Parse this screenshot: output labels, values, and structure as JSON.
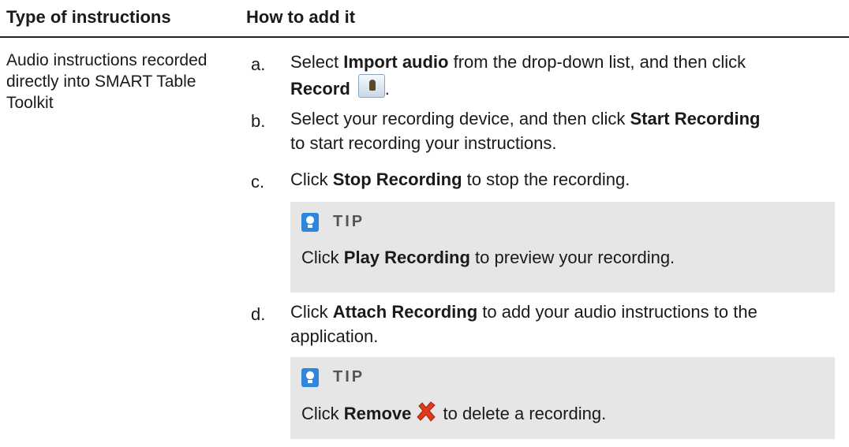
{
  "table": {
    "headers": [
      "Type of instructions",
      "How to add it"
    ],
    "left_cell": "Audio instructions recorded directly into SMART Table Toolkit"
  },
  "steps": {
    "a": {
      "letter": "a.",
      "text1": "Select ",
      "bold1": "Import audio",
      "text2": " from the drop-down list, and then click",
      "bold2": "Record",
      "text3": "."
    },
    "b": {
      "letter": "b.",
      "text1": "Select your recording device, and then click ",
      "bold1": "Start Recording",
      "text2": "to start recording your instructions."
    },
    "c": {
      "letter": "c.",
      "text1": "Click ",
      "bold1": "Stop Recording",
      "text2": " to stop the recording."
    },
    "d": {
      "letter": "d.",
      "text1": "Click ",
      "bold1": "Attach Recording",
      "text2": " to add your audio instructions to the",
      "text3": "application."
    }
  },
  "tips": {
    "tip1": {
      "title": "TIP",
      "text1": "Click ",
      "bold1": "Play Recording",
      "text2": " to preview your recording."
    },
    "tip2": {
      "title": "TIP",
      "text1": "Click ",
      "bold1": "Remove",
      "text2": " to delete a recording."
    }
  },
  "icons": {
    "tip": "lightbulb-icon",
    "record": "record-icon",
    "remove": "remove-x-icon"
  },
  "colors": {
    "tip_background": "#e6e6e6",
    "tip_icon": "#2e86de",
    "remove_icon": "#e03a1e"
  }
}
